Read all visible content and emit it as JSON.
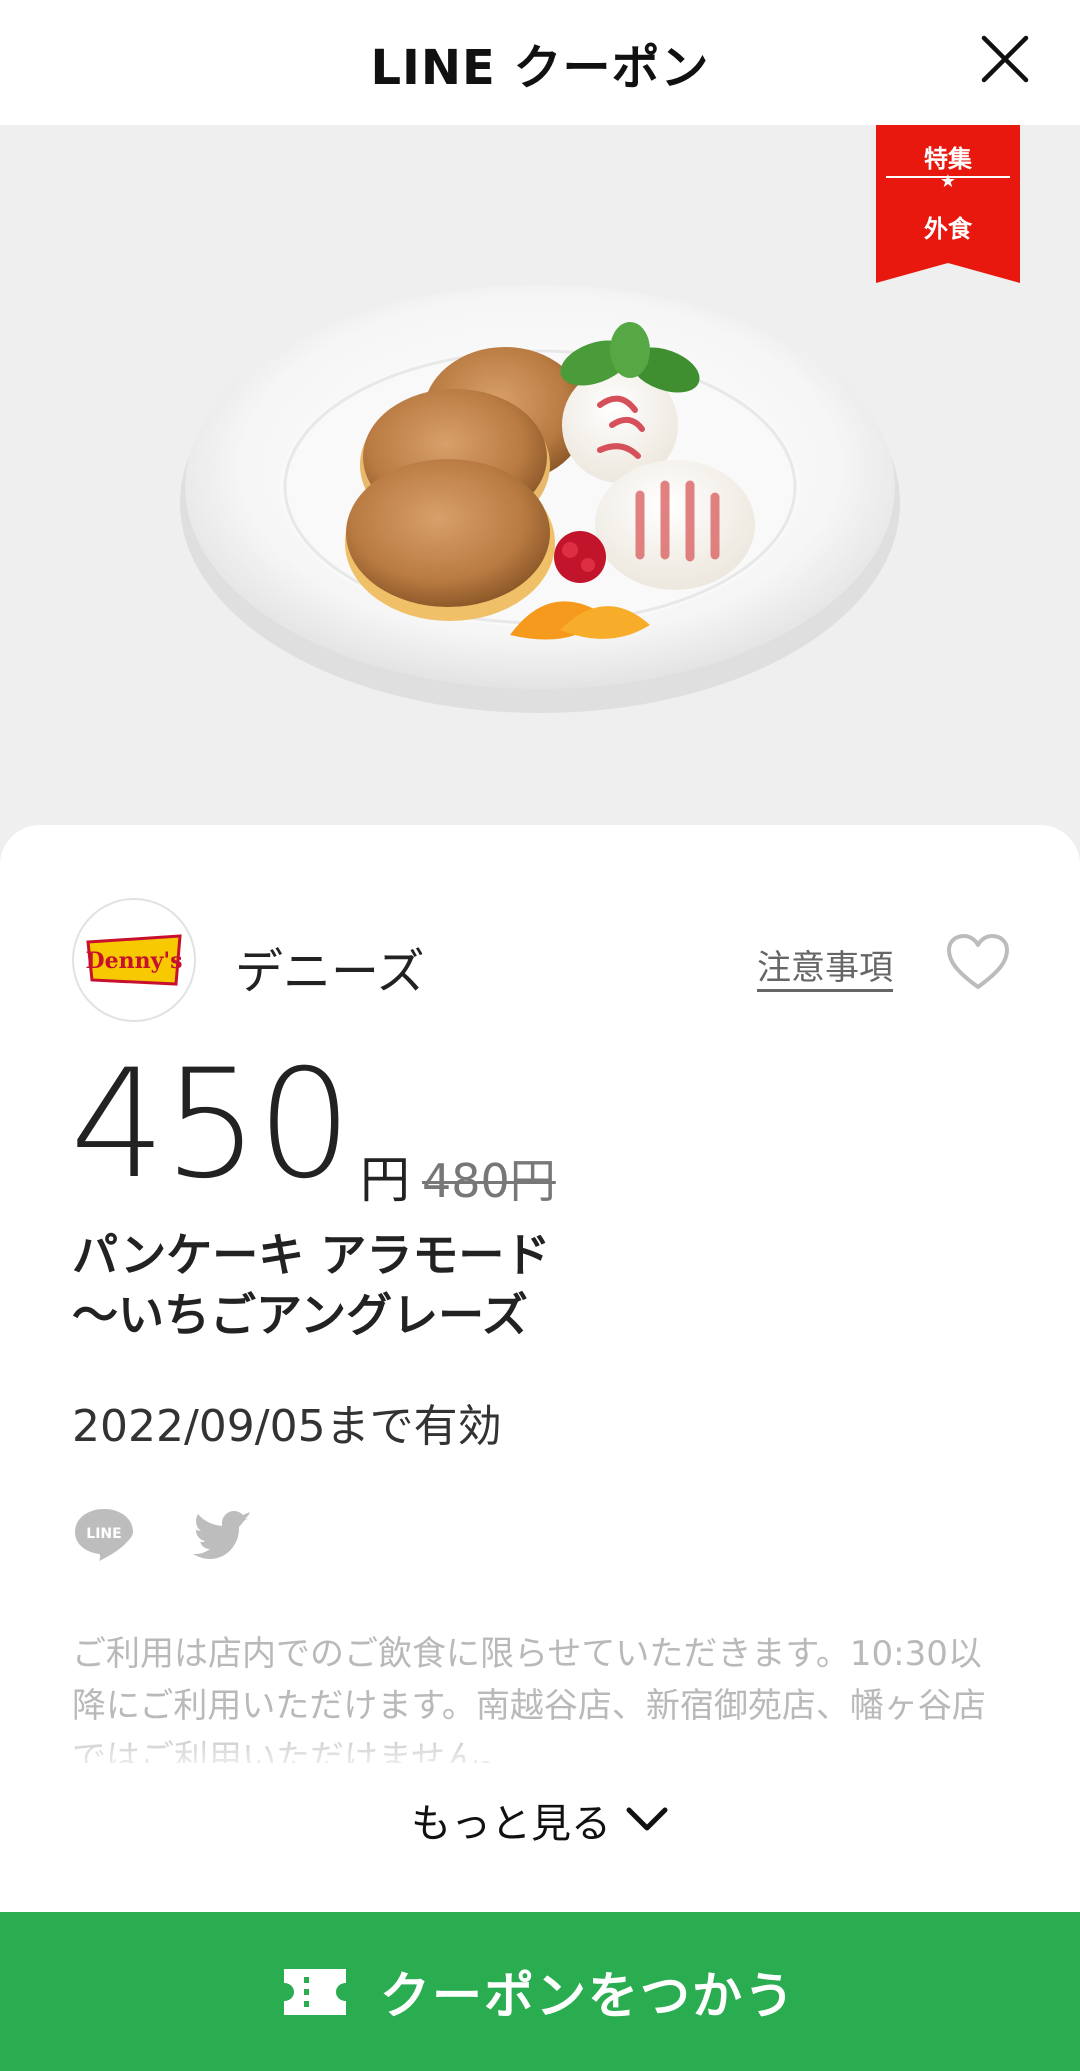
{
  "header": {
    "title": "LINE クーポン"
  },
  "hero": {
    "ribbon_top": "特集",
    "ribbon_bottom": "外食"
  },
  "store": {
    "name": "デニーズ",
    "logo_text": "Denny's",
    "notice_label": "注意事項"
  },
  "price": {
    "current": "450",
    "unit": "円",
    "original": "480円"
  },
  "item": {
    "name": "パンケーキ アラモード\n〜いちごアングレーズ"
  },
  "validity": "2022/09/05まで有効",
  "share": {
    "line_label": "LINE"
  },
  "description": "ご利用は店内でのご飲食に限らせていただきます。10:30以降にご利用いただけます。南越谷店、新宿御苑店、幡ヶ谷店ではご利用いただけません。",
  "more_label": "もっと見る",
  "cta_label": "クーポンをつかう",
  "colors": {
    "brand_green": "#2aac50",
    "ribbon_red": "#e8180f",
    "logo_yellow": "#f6c900"
  }
}
